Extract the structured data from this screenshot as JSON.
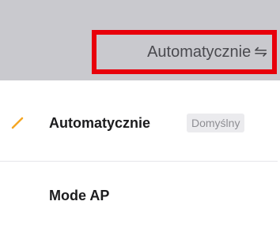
{
  "header": {
    "selector_label": "Automatycznie",
    "selector_icon": "swap-arrows-icon"
  },
  "menu": {
    "items": [
      {
        "label": "Automatycznie",
        "badge": "Domyślny",
        "selected": true,
        "check_icon": "checkmark-icon"
      },
      {
        "label": "Mode AP",
        "selected": false
      }
    ]
  },
  "colors": {
    "highlight_border": "#e8000b",
    "checkmark": "#f5a623",
    "top_bar": "#c9c9ce"
  }
}
